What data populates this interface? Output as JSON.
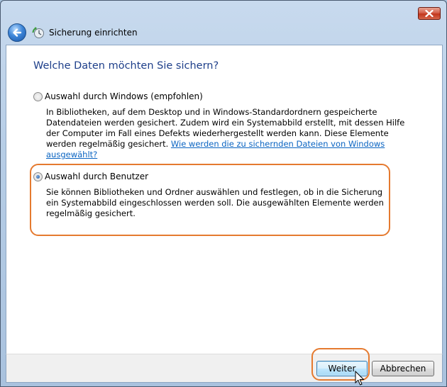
{
  "window": {
    "title": "Sicherung einrichten"
  },
  "page": {
    "heading": "Welche Daten möchten Sie sichern?"
  },
  "options": [
    {
      "label": "Auswahl durch Windows (empfohlen)",
      "checked": false,
      "description": "In Bibliotheken, auf dem Desktop und in Windows-Standardordnern gespeicherte Datendateien werden gesichert. Zudem wird ein Systemabbild erstellt, mit dessen Hilfe der Computer im Fall eines Defekts wiederhergestellt werden kann. Diese Elemente werden regelmäßig gesichert.",
      "link": "Wie werden die zu sichernden Dateien von Windows ausgewählt?"
    },
    {
      "label": "Auswahl durch Benutzer",
      "checked": true,
      "description": "Sie können Bibliotheken und Ordner auswählen und festlegen, ob in die Sicherung ein Systemabbild eingeschlossen werden soll. Die ausgewählten Elemente werden regelmäßig gesichert."
    }
  ],
  "buttons": {
    "next": "Weiter",
    "cancel": "Abbrechen"
  },
  "colors": {
    "heading": "#1e3f8a",
    "link": "#0a64c2",
    "highlight": "#e57a2f"
  },
  "icons": {
    "close": "close-icon",
    "back": "back-arrow-icon",
    "app": "backup-icon",
    "cursor": "mouse-pointer-icon"
  }
}
